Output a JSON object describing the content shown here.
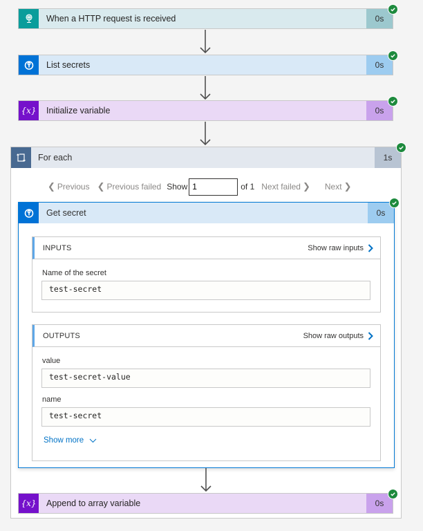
{
  "steps": [
    {
      "title": "When a HTTP request is received",
      "duration": "0s",
      "icon": "http-request-icon",
      "status": "succeeded"
    },
    {
      "title": "List secrets",
      "duration": "0s",
      "icon": "key-vault-icon",
      "status": "succeeded"
    },
    {
      "title": "Initialize variable",
      "duration": "0s",
      "icon": "variable-icon",
      "status": "succeeded"
    }
  ],
  "foreach": {
    "title": "For each",
    "duration": "1s",
    "icon": "loop-icon",
    "status": "succeeded",
    "pager": {
      "previous": "Previous",
      "previous_failed": "Previous failed",
      "show_label": "Show",
      "current": "1",
      "of_label": "of 1",
      "next_failed": "Next failed",
      "next": "Next"
    },
    "inner": {
      "title": "Get secret",
      "duration": "0s",
      "icon": "key-vault-icon",
      "status": "succeeded",
      "inputs": {
        "heading": "INPUTS",
        "raw_link": "Show raw inputs",
        "fields": [
          {
            "label": "Name of the secret",
            "value": "test-secret"
          }
        ]
      },
      "outputs": {
        "heading": "OUTPUTS",
        "raw_link": "Show raw outputs",
        "fields": [
          {
            "label": "value",
            "value": "test-secret-value"
          },
          {
            "label": "name",
            "value": "test-secret"
          }
        ],
        "show_more": "Show more"
      }
    },
    "after": {
      "title": "Append to array variable",
      "duration": "0s",
      "icon": "variable-icon",
      "status": "succeeded"
    }
  },
  "variable_icon_glyph": "{x}"
}
